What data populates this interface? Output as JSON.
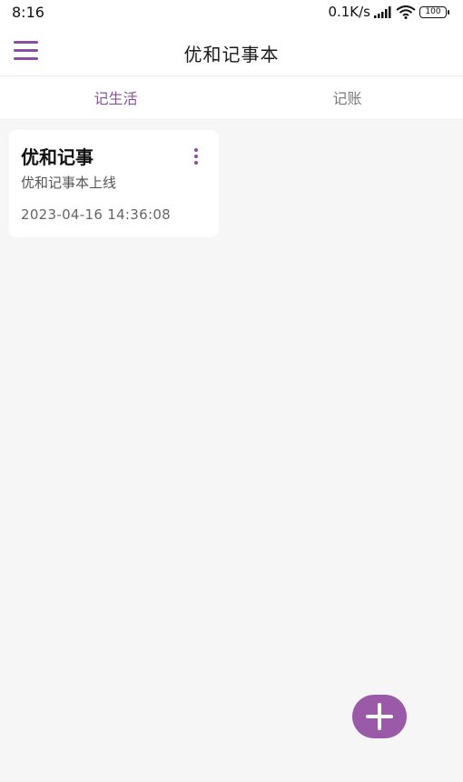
{
  "status_bar": {
    "time": "8:16",
    "network_speed": "0.1K/s",
    "battery": "100",
    "icons": [
      "signal-icon",
      "wifi-icon",
      "battery-icon"
    ]
  },
  "app_bar": {
    "title": "优和记事本",
    "menu_icon": "menu-icon"
  },
  "tabs": [
    {
      "label": "记生活",
      "active": true
    },
    {
      "label": "记账",
      "active": false
    }
  ],
  "notes": [
    {
      "title": "优和记事",
      "content": "优和记事本上线",
      "time": "2023-04-16 14:36:08",
      "menu_icon": "more-vertical-icon"
    }
  ],
  "fab": {
    "icon": "plus-icon"
  },
  "colors": {
    "accent": "#8a4f9e",
    "fab": "#9a5aa8",
    "background": "#f6f6f7"
  }
}
